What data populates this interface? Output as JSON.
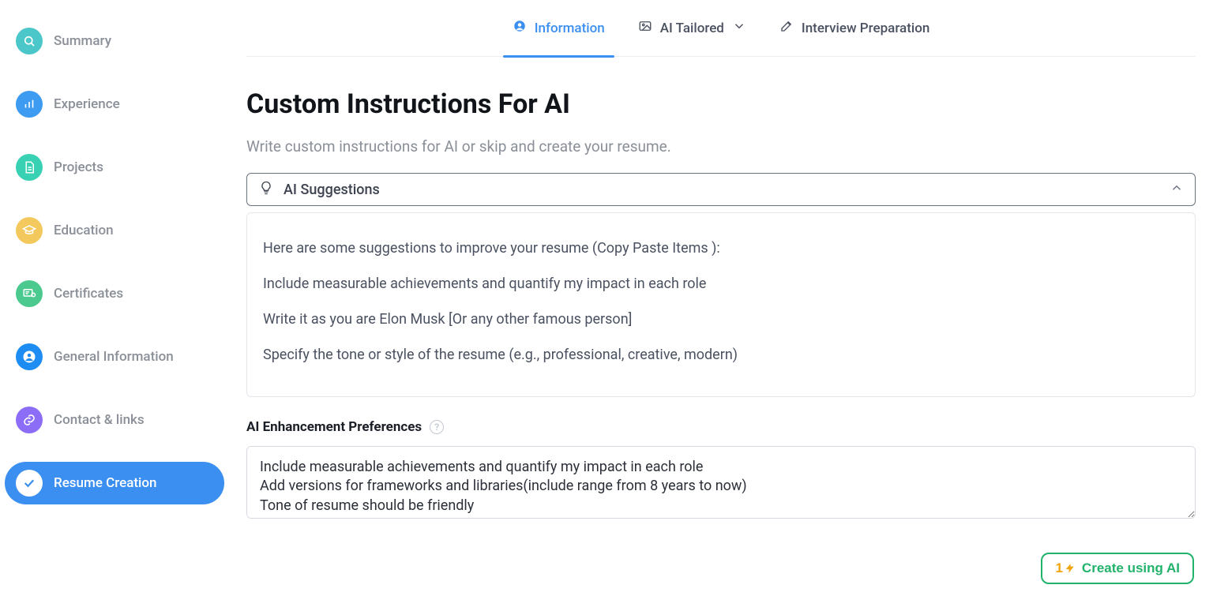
{
  "sidebar": {
    "items": [
      {
        "label": "Summary",
        "icon": "search",
        "bg": "#4cc7c9"
      },
      {
        "label": "Experience",
        "icon": "bars",
        "bg": "#3d9cf2"
      },
      {
        "label": "Projects",
        "icon": "doc",
        "bg": "#38d1b3"
      },
      {
        "label": "Education",
        "icon": "grad",
        "bg": "#f3c95d"
      },
      {
        "label": "Certificates",
        "icon": "cert",
        "bg": "#4bc98e"
      },
      {
        "label": "General Information",
        "icon": "person",
        "bg": "#1d8cf3"
      },
      {
        "label": "Contact & links",
        "icon": "link",
        "bg": "#8b6df7"
      },
      {
        "label": "Resume Creation",
        "icon": "check",
        "bg": "#ffffff",
        "active": true,
        "checkColor": "#3b8ff0"
      }
    ]
  },
  "tabs": [
    {
      "label": "Information",
      "icon": "user-circle",
      "active": true
    },
    {
      "label": "AI Tailored",
      "icon": "image",
      "hasDropdown": true
    },
    {
      "label": "Interview Preparation",
      "icon": "edit"
    }
  ],
  "title": "Custom Instructions For AI",
  "subtitle": "Write custom instructions for AI or skip and create your resume.",
  "accordion": {
    "label": "AI Suggestions"
  },
  "suggestions": {
    "intro": "Here are some suggestions to improve your resume (Copy Paste Items ):",
    "items": [
      "Include measurable achievements and quantify my impact in each role",
      "Write it as you are Elon Musk [Or any other famous person]",
      "Specify the tone or style of the resume (e.g., professional, creative, modern)"
    ]
  },
  "pref": {
    "label": "AI Enhancement Preferences",
    "value": "Include measurable achievements and quantify my impact in each role\nAdd versions for frameworks and libraries(include range from 8 years to now)\nTone of resume should be friendly"
  },
  "create": {
    "badge": "1",
    "label": "Create using AI"
  }
}
